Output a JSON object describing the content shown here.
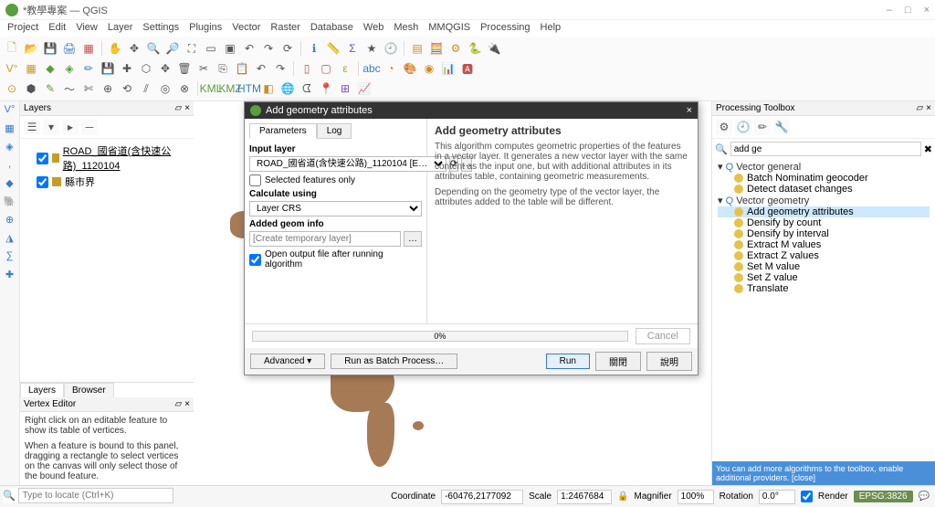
{
  "window": {
    "title": "*教學專案 — QGIS",
    "min": "–",
    "max": "□",
    "close": "×"
  },
  "menu": [
    "Project",
    "Edit",
    "View",
    "Layer",
    "Settings",
    "Plugins",
    "Vector",
    "Raster",
    "Database",
    "Web",
    "Mesh",
    "MMQGIS",
    "Processing",
    "Help"
  ],
  "layers": {
    "header": "Layers",
    "items": [
      {
        "checked": true,
        "swatch": "#c79a2a",
        "label": "ROAD_國省道(含快速公路)_1120104",
        "ul": true
      },
      {
        "checked": true,
        "swatch": "#c79a2a",
        "label": "縣市界"
      }
    ],
    "tabs": [
      "Layers",
      "Browser"
    ],
    "active_tab": 0
  },
  "vertex": {
    "title": "Vertex Editor",
    "l1": "Right click on an editable feature to show its table of vertices.",
    "l2": "When a feature is bound to this panel, dragging a rectangle to select vertices on the canvas will only select those of the bound feature."
  },
  "locator": {
    "ph": "Type to locate (Ctrl+K)"
  },
  "status": {
    "coord_lbl": "Coordinate",
    "coord": "-60476,2177092",
    "scale_lbl": "Scale",
    "scale": "1:2467684",
    "mag_lbl": "Magnifier",
    "mag": "100%",
    "rot_lbl": "Rotation",
    "rot": "0.0°",
    "render": "Render",
    "crs": "EPSG:3826"
  },
  "toolbox": {
    "header": "Processing Toolbox",
    "search": "add ge",
    "groups": [
      {
        "name": "Vector general",
        "open": true,
        "algos": [
          "Batch Nominatim geocoder",
          "Detect dataset changes"
        ]
      },
      {
        "name": "Vector geometry",
        "open": true,
        "algos": [
          "Add geometry attributes",
          "Densify by count",
          "Densify by interval",
          "Extract M values",
          "Extract Z values",
          "Set M value",
          "Set Z value",
          "Translate"
        ]
      }
    ],
    "selected": "Add geometry attributes",
    "tip": "You can add more algorithms to the toolbox, enable additional providers. [close]"
  },
  "dialog": {
    "title": "Add geometry attributes",
    "tabs": [
      "Parameters",
      "Log"
    ],
    "active_tab": 0,
    "input_layer_lbl": "Input layer",
    "input_layer_val": "ROAD_國省道(含快速公路)_1120104 [E…",
    "sel_only": "Selected features only",
    "calc_lbl": "Calculate using",
    "calc_val": "Layer CRS",
    "added_lbl": "Added geom info",
    "added_ph": "[Create temporary layer]",
    "open_chk": "Open output file after running algorithm",
    "help_h": "Add geometry attributes",
    "help_1": "This algorithm computes geometric properties of the features in a vector layer. It generates a new vector layer with the same content as the input one, but with additional attributes in its attributes table, containing geometric measurements.",
    "help_2": "Depending on the geometry type of the vector layer, the attributes added to the table will be different.",
    "progress": "0%",
    "adv": "Advanced",
    "batch": "Run as Batch Process…",
    "run": "Run",
    "close": "關閉",
    "help": "說明",
    "cancel": "Cancel"
  }
}
